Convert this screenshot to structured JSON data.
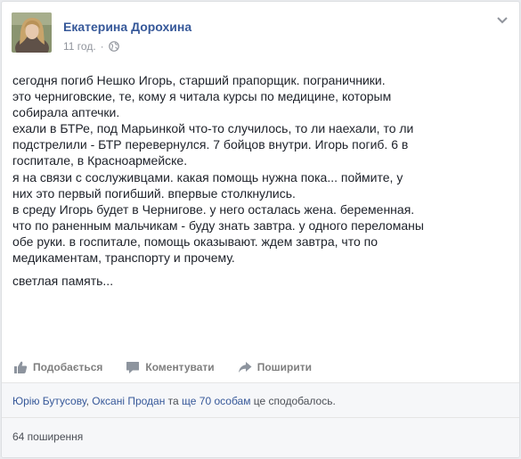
{
  "post": {
    "author": "Екатерина Дорохина",
    "time": "11 год.",
    "separator": "·",
    "privacy_icon": "globe-icon",
    "menu_icon": "chevron-down-icon",
    "text_lines": [
      "сегодня погиб Нешко Игорь, старший прапорщик. пограничники.",
      "это черниговские, те, кому я читала курсы по медицине, которым",
      "собирала аптечки.",
      "ехали в БТРе, под Марьинкой что-то случилось, то ли наехали, то ли",
      "подстрелили - БТР перевернулся. 7 бойцов внутри. Игорь погиб. 6 в",
      "госпитале, в Красноармейске.",
      "я на связи с сослуживцами. какая помощь нужна пока... поймите, у",
      "них это первый погибший. впервые столкнулись.",
      "в среду Игорь будет в Чернигове. у него осталась жена. беременная.",
      "что по раненным мальчикам - буду знать завтра. у одного переломаны",
      "обе руки. в госпитале, помощь оказывают. ждем завтра, что по",
      "медикаментам, транспорту и прочему."
    ],
    "closing_line": "светлая память..."
  },
  "actions": {
    "like": {
      "label": "Подобається",
      "icon": "thumbs-up-icon"
    },
    "comment": {
      "label": "Коментувати",
      "icon": "comment-icon"
    },
    "share": {
      "label": "Поширити",
      "icon": "share-arrow-icon"
    }
  },
  "reactions": {
    "user1": "Юрію Бутусову",
    "sep": ", ",
    "user2": "Оксані Продан",
    "and": " та ",
    "others": "ще 70 особам",
    "suffix": " це сподобалось."
  },
  "shares": {
    "label": "64 поширення"
  },
  "colors": {
    "link": "#365899",
    "text": "#1d2129",
    "muted": "#90949c",
    "action": "#7f7f7f",
    "footer_bg": "#f6f7f9"
  }
}
